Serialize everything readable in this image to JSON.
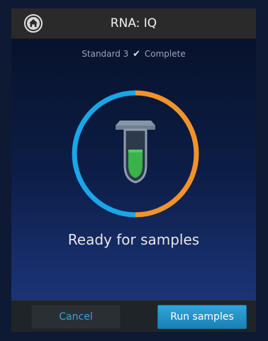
{
  "header": {
    "title": "RNA: IQ",
    "home_icon": "home-icon"
  },
  "status": {
    "prefix": "Standard 3",
    "check_icon": "check-icon",
    "check_glyph": "✔",
    "suffix": "Complete"
  },
  "main": {
    "message": "Ready for samples",
    "tube_icon": "sample-tube-icon",
    "ring_colors": {
      "left": "#1aa6e8",
      "right": "#f2932a"
    },
    "liquid_color": "#3ab34a"
  },
  "footer": {
    "cancel_label": "Cancel",
    "run_label": "Run samples"
  }
}
